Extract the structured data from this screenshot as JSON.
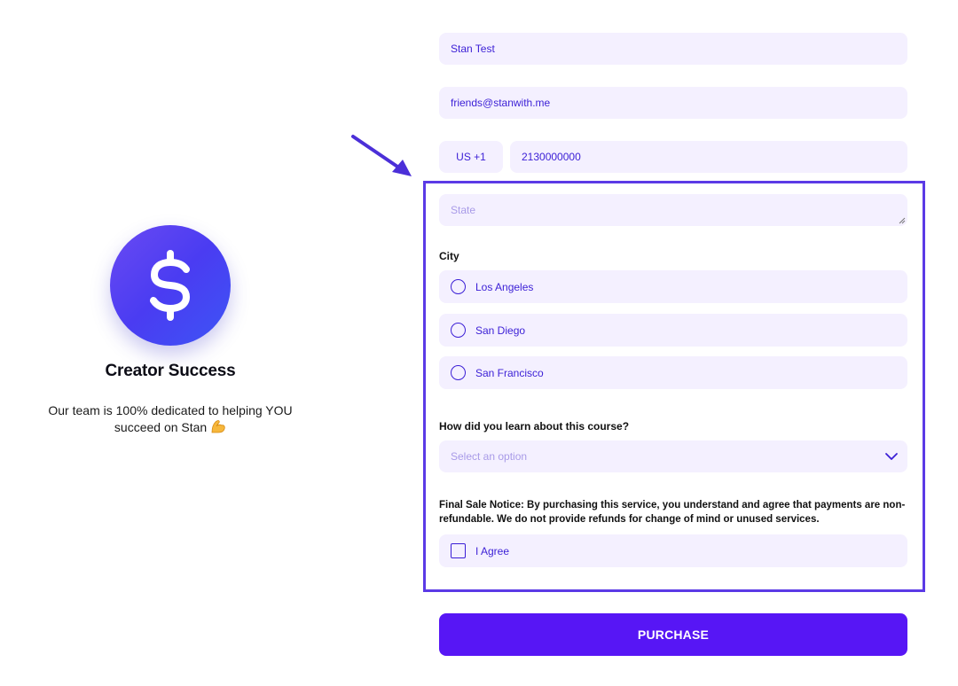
{
  "promo": {
    "icon": "dollar-icon",
    "title": "Creator Success",
    "text": "Our team is 100% dedicated to helping YOU succeed on Stan",
    "emoji": "flexed-biceps-emoji"
  },
  "form": {
    "name_value": "Stan Test",
    "email_value": "friends@stanwith.me",
    "country_code": "US +1",
    "phone_value": "2130000000",
    "state_placeholder": "State",
    "city_label": "City",
    "city_options": [
      "Los Angeles",
      "San Diego",
      "San Francisco"
    ],
    "learn_label": "How did you learn about this course?",
    "learn_placeholder": "Select an option",
    "notice": "Final Sale Notice: By purchasing this service, you understand and agree that payments are non-refundable. We do not provide refunds for change of mind or unused services.",
    "agree_label": "I Agree",
    "purchase_label": "PURCHASE"
  },
  "colors": {
    "accent": "#5716f5",
    "field_bg": "#f4f0ff",
    "field_text": "#3b1fd6",
    "highlight": "#5b3ae6"
  }
}
